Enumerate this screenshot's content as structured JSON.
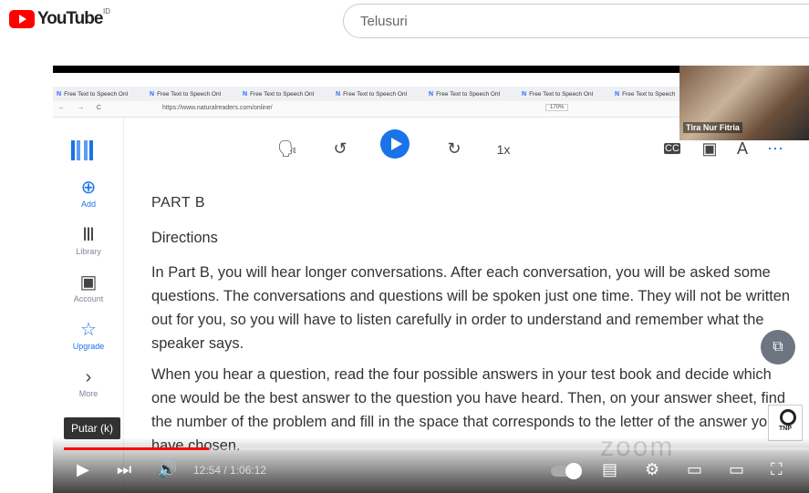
{
  "youtube": {
    "logo_text": "YouTube",
    "region": "ID",
    "search_placeholder": "Telusuri"
  },
  "browser": {
    "tabs": [
      "Free Text to Speech Onl",
      "Free Text to Speech Onl",
      "Free Text to Speech Onl",
      "Free Text to Speech Onl",
      "Free Text to Speech Onl",
      "Free Text to Speech Onl",
      "Free Text to Speech"
    ],
    "url": "https://www.naturalreaders.com/online/",
    "zoom": "170%"
  },
  "app": {
    "sidebar": [
      {
        "label": "Add",
        "icon": "plus-circle-icon"
      },
      {
        "label": "Library",
        "icon": "library-icon"
      },
      {
        "label": "Account",
        "icon": "account-icon"
      },
      {
        "label": "Upgrade",
        "icon": "star-icon"
      },
      {
        "label": "More",
        "icon": "chevron-right-icon"
      }
    ],
    "toolbar": {
      "speed": "1x"
    },
    "heading": "PART B",
    "subheading": "Directions",
    "para1": "In Part B, you will hear longer conversations. After each conversation, you will be asked some questions. The conversations and questions will be spoken just one time. They will not be written out for you, so you will have to listen carefully in order to understand and remember what the speaker says.",
    "para2": "When you hear a question, read the four possible answers in your test book and decide which one would be the best answer to the question you have heard. Then, on your answer sheet, find the number of the problem and fill in the space that corresponds to the letter of the answer you have chosen."
  },
  "webcam": {
    "name": "Tira Nur Fitria"
  },
  "logo_badge": {
    "text": "TNP"
  },
  "player": {
    "tooltip": "Putar (k)",
    "time": "12:54 / 1:06:12",
    "progress": 0.195
  }
}
